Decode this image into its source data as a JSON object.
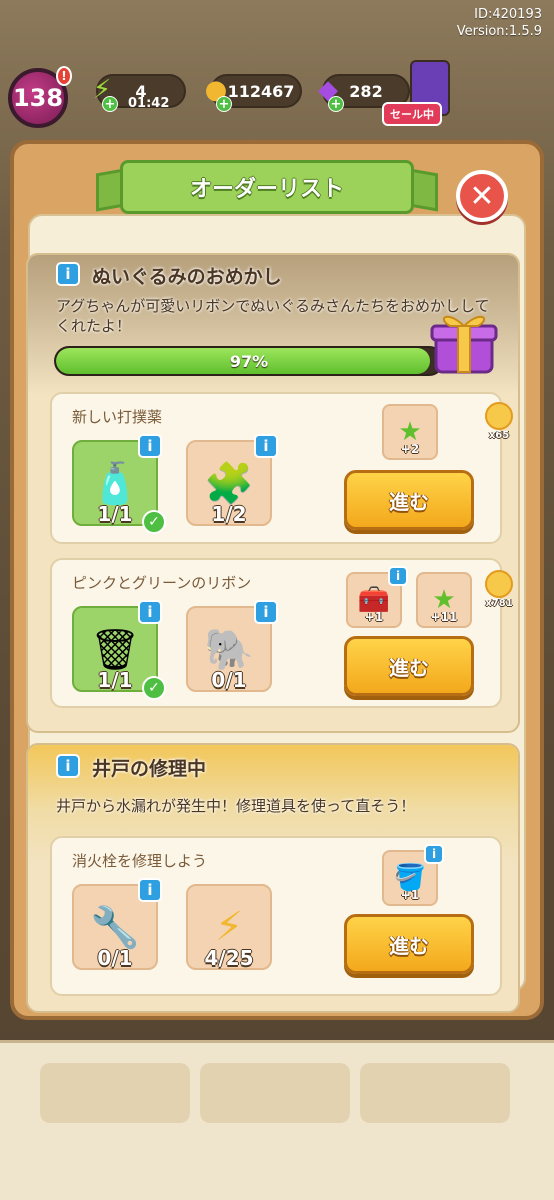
{
  "meta": {
    "id": "ID:420193",
    "version": "Version:1.5.9"
  },
  "status": {
    "level": "138",
    "energy": "4",
    "energy_timer": "01:42",
    "coins": "112467",
    "gems": "282",
    "sale_label": "セール中"
  },
  "panel": {
    "title": "オーダーリスト"
  },
  "order1": {
    "title": "ぬいぐるみのおめかし",
    "desc": "アグちゃんが可愛いリボンでぬいぐるみさんたちをおめかししてくれたよ！",
    "progress_percent": 97,
    "progress_label": "97%",
    "tasks": [
      {
        "title": "新しい打撲薬",
        "items": [
          {
            "icon": "medicine-bottle-icon",
            "glyph": "🧴",
            "count": "1/1",
            "done": true
          },
          {
            "icon": "blue-puzzle-piece-icon",
            "glyph": "🧩",
            "count": "1/2",
            "done": false
          }
        ],
        "rewards": [
          {
            "icon": "green-star-icon",
            "glyph": "★",
            "count": "+2"
          }
        ],
        "side_count": "x65",
        "button": "進む"
      },
      {
        "title": "ピンクとグリーンのリボン",
        "items": [
          {
            "icon": "raccoon-trash-bin-icon",
            "glyph": "🗑",
            "count": "1/1",
            "done": true
          },
          {
            "icon": "elephant-plush-icon",
            "glyph": "🐘",
            "count": "0/1",
            "done": false
          }
        ],
        "rewards": [
          {
            "icon": "toolbox-icon",
            "glyph": "🧰",
            "count": "+1"
          },
          {
            "icon": "green-star-icon",
            "glyph": "★",
            "count": "+11"
          }
        ],
        "side_count": "x781",
        "button": "進む"
      }
    ]
  },
  "order2": {
    "title": "井戸の修理中",
    "desc": "井戸から水漏れが発生中！修理道具を使って直そう！",
    "task": {
      "title": "消火栓を修理しよう",
      "items": [
        {
          "icon": "wrench-icon",
          "glyph": "🔧",
          "count": "0/1"
        },
        {
          "icon": "lightning-icon",
          "glyph": "⚡",
          "count": "4/25"
        }
      ],
      "reward": {
        "icon": "bucket-icon",
        "glyph": "🪣",
        "count": "+1"
      },
      "button": "進む"
    }
  },
  "colors": {
    "accent_green": "#9dd25a",
    "button_orange": "#f3a81c",
    "close_red": "#e8534a",
    "info_blue": "#2e9fe0"
  }
}
